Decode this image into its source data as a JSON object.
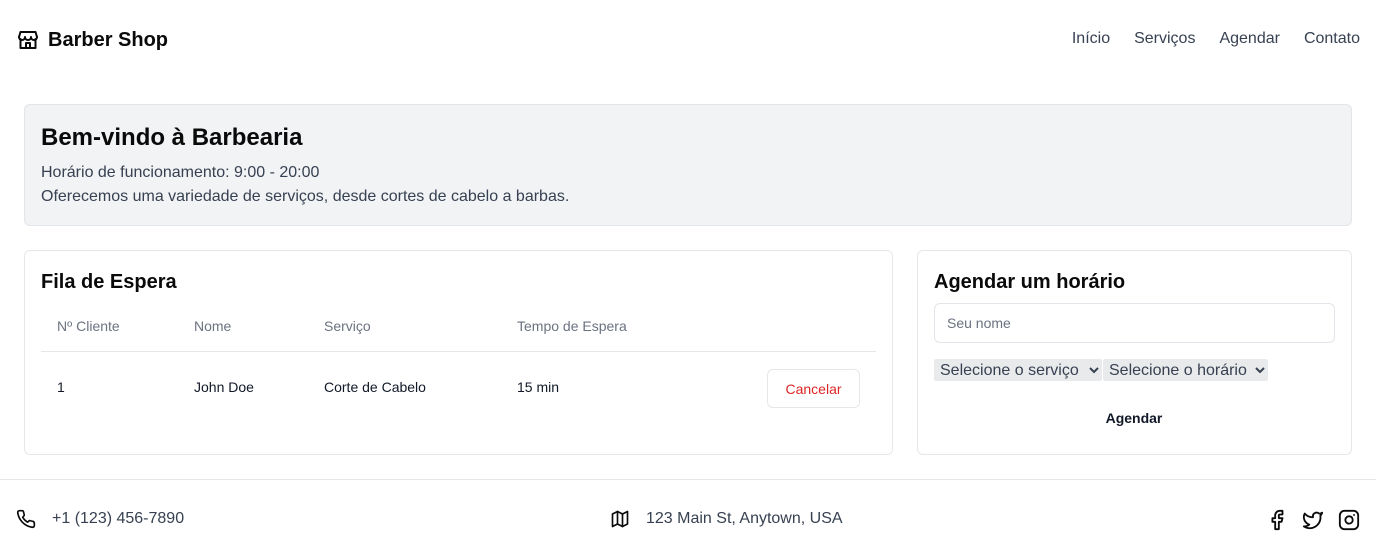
{
  "header": {
    "brand": "Barber Shop",
    "brand_icon": "store-icon",
    "nav": [
      "Início",
      "Serviços",
      "Agendar",
      "Contato"
    ]
  },
  "welcome": {
    "title": "Bem-vindo à Barbearia",
    "hours": "Horário de funcionamento: 9:00 - 20:00",
    "description": "Oferecemos uma variedade de serviços, desde cortes de cabelo a barbas."
  },
  "queue": {
    "title": "Fila de Espera",
    "columns": [
      "Nº Cliente",
      "Nome",
      "Serviço",
      "Tempo de Espera"
    ],
    "rows": [
      {
        "number": "1",
        "name": "John Doe",
        "service": "Corte de Cabelo",
        "wait": "15 min",
        "action": "Cancelar"
      }
    ]
  },
  "booking": {
    "title": "Agendar um horário",
    "name_placeholder": "Seu nome",
    "service_select": "Selecione o serviço",
    "time_select": "Selecione o horário",
    "submit": "Agendar"
  },
  "footer": {
    "phone": "+1 (123) 456-7890",
    "address": "123 Main St, Anytown, USA",
    "social": [
      "facebook-icon",
      "twitter-icon",
      "instagram-icon"
    ]
  },
  "colors": {
    "cancel": "#dc2626",
    "panel_bg": "#f1f3f5",
    "border": "#e5e7eb"
  }
}
